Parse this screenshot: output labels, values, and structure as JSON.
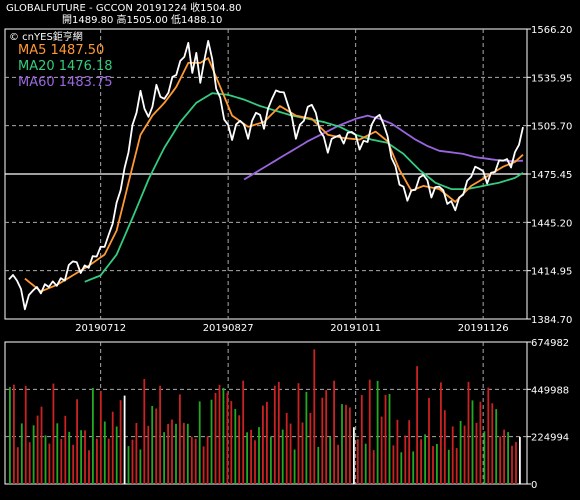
{
  "header": {
    "line1": "GLOBALFUTURE  -  GCCON    20191224    收1504.80",
    "line2": "開1489.80    高1505.00    低1488.10"
  },
  "watermark": "© cnYES鉅亨網",
  "colors": {
    "price": "#ffffff",
    "ma5": "#ff9933",
    "ma20": "#33cc80",
    "ma60": "#9966dd",
    "up_volume": "#cc2222",
    "down_volume": "#22aa22",
    "flat_volume": "#ffffff",
    "frame": "#ffffff",
    "grid": "#aaaaaa"
  },
  "chart_data": [
    {
      "type": "line",
      "panel": "price",
      "series": [
        {
          "name": "MA5",
          "label": "MA5 1487.50",
          "latest": 1487.5
        },
        {
          "name": "MA20",
          "label": "MA20 1476.18",
          "latest": 1476.18
        },
        {
          "name": "MA60",
          "label": "MA60 1483.75",
          "latest": 1483.75
        },
        {
          "name": "price",
          "latest": 1504.8
        }
      ],
      "y_ticks": [
        "1566.20",
        "1535.95",
        "1505.70",
        "1475.45",
        "1445.20",
        "1414.95",
        "1384.70"
      ],
      "ylim": [
        1384.7,
        1566.2
      ],
      "x_ticks": [
        "20190712",
        "20190827",
        "20191011",
        "20191126"
      ],
      "x_tick_index": [
        23,
        55,
        87,
        119
      ],
      "n_points": 130,
      "highlight_level": 1475.45,
      "price_keypoints": [
        [
          0,
          1412
        ],
        [
          2,
          1410
        ],
        [
          4,
          1392
        ],
        [
          6,
          1405
        ],
        [
          8,
          1402
        ],
        [
          10,
          1406
        ],
        [
          12,
          1408
        ],
        [
          14,
          1410
        ],
        [
          16,
          1422
        ],
        [
          18,
          1416
        ],
        [
          20,
          1418
        ],
        [
          22,
          1425
        ],
        [
          25,
          1436
        ],
        [
          27,
          1455
        ],
        [
          29,
          1478
        ],
        [
          31,
          1505
        ],
        [
          33,
          1525
        ],
        [
          35,
          1510
        ],
        [
          37,
          1530
        ],
        [
          39,
          1520
        ],
        [
          41,
          1535
        ],
        [
          43,
          1545
        ],
        [
          45,
          1555
        ],
        [
          46,
          1540
        ],
        [
          47,
          1550
        ],
        [
          48,
          1535
        ],
        [
          49,
          1545
        ],
        [
          50,
          1560
        ],
        [
          51,
          1545
        ],
        [
          52,
          1530
        ],
        [
          53,
          1522
        ],
        [
          54,
          1512
        ],
        [
          56,
          1498
        ],
        [
          58,
          1510
        ],
        [
          60,
          1500
        ],
        [
          62,
          1515
        ],
        [
          64,
          1505
        ],
        [
          66,
          1525
        ],
        [
          68,
          1528
        ],
        [
          70,
          1520
        ],
        [
          72,
          1500
        ],
        [
          74,
          1510
        ],
        [
          76,
          1520
        ],
        [
          78,
          1505
        ],
        [
          80,
          1490
        ],
        [
          82,
          1500
        ],
        [
          84,
          1497
        ],
        [
          86,
          1503
        ],
        [
          88,
          1492
        ],
        [
          90,
          1498
        ],
        [
          92,
          1512
        ],
        [
          94,
          1508
        ],
        [
          96,
          1488
        ],
        [
          98,
          1470
        ],
        [
          100,
          1460
        ],
        [
          102,
          1468
        ],
        [
          104,
          1476
        ],
        [
          106,
          1462
        ],
        [
          108,
          1470
        ],
        [
          110,
          1458
        ],
        [
          112,
          1454
        ],
        [
          114,
          1465
        ],
        [
          116,
          1475
        ],
        [
          118,
          1480
        ],
        [
          120,
          1472
        ],
        [
          122,
          1478
        ],
        [
          124,
          1485
        ],
        [
          126,
          1482
        ],
        [
          127,
          1488
        ],
        [
          128,
          1495
        ],
        [
          129,
          1504.8
        ]
      ],
      "ma5_keypoints": [
        [
          4,
          1410
        ],
        [
          8,
          1402
        ],
        [
          12,
          1406
        ],
        [
          16,
          1412
        ],
        [
          20,
          1418
        ],
        [
          24,
          1425
        ],
        [
          27,
          1440
        ],
        [
          30,
          1470
        ],
        [
          33,
          1500
        ],
        [
          36,
          1512
        ],
        [
          39,
          1520
        ],
        [
          42,
          1530
        ],
        [
          45,
          1545
        ],
        [
          48,
          1545
        ],
        [
          50,
          1548
        ],
        [
          53,
          1530
        ],
        [
          56,
          1512
        ],
        [
          60,
          1505
        ],
        [
          64,
          1508
        ],
        [
          68,
          1518
        ],
        [
          72,
          1512
        ],
        [
          76,
          1510
        ],
        [
          80,
          1500
        ],
        [
          84,
          1498
        ],
        [
          88,
          1497
        ],
        [
          92,
          1502
        ],
        [
          95,
          1496
        ],
        [
          98,
          1478
        ],
        [
          101,
          1465
        ],
        [
          104,
          1468
        ],
        [
          108,
          1466
        ],
        [
          112,
          1458
        ],
        [
          116,
          1468
        ],
        [
          120,
          1474
        ],
        [
          124,
          1480
        ],
        [
          127,
          1483
        ],
        [
          129,
          1487.5
        ]
      ],
      "ma20_keypoints": [
        [
          19,
          1408
        ],
        [
          23,
          1412
        ],
        [
          27,
          1425
        ],
        [
          31,
          1448
        ],
        [
          35,
          1472
        ],
        [
          39,
          1492
        ],
        [
          43,
          1508
        ],
        [
          47,
          1520
        ],
        [
          51,
          1526
        ],
        [
          55,
          1525
        ],
        [
          59,
          1522
        ],
        [
          63,
          1518
        ],
        [
          67,
          1515
        ],
        [
          71,
          1512
        ],
        [
          75,
          1510
        ],
        [
          79,
          1508
        ],
        [
          83,
          1505
        ],
        [
          87,
          1500
        ],
        [
          91,
          1497
        ],
        [
          95,
          1495
        ],
        [
          99,
          1488
        ],
        [
          103,
          1478
        ],
        [
          107,
          1470
        ],
        [
          111,
          1466
        ],
        [
          115,
          1466
        ],
        [
          119,
          1468
        ],
        [
          123,
          1470
        ],
        [
          127,
          1473
        ],
        [
          129,
          1476.18
        ]
      ],
      "ma60_keypoints": [
        [
          59,
          1472
        ],
        [
          63,
          1478
        ],
        [
          67,
          1484
        ],
        [
          71,
          1490
        ],
        [
          75,
          1496
        ],
        [
          79,
          1501
        ],
        [
          83,
          1506
        ],
        [
          87,
          1510
        ],
        [
          90,
          1512
        ],
        [
          93,
          1510
        ],
        [
          96,
          1507
        ],
        [
          99,
          1502
        ],
        [
          102,
          1497
        ],
        [
          105,
          1493
        ],
        [
          108,
          1490
        ],
        [
          111,
          1489
        ],
        [
          114,
          1488
        ],
        [
          117,
          1486
        ],
        [
          120,
          1485
        ],
        [
          123,
          1484
        ],
        [
          126,
          1483.5
        ],
        [
          129,
          1483.75
        ]
      ]
    },
    {
      "type": "bar",
      "panel": "volume",
      "y_ticks": [
        "674982",
        "449988",
        "224994",
        "0"
      ],
      "ylim": [
        0,
        674982
      ],
      "n_bars": 130
    }
  ]
}
